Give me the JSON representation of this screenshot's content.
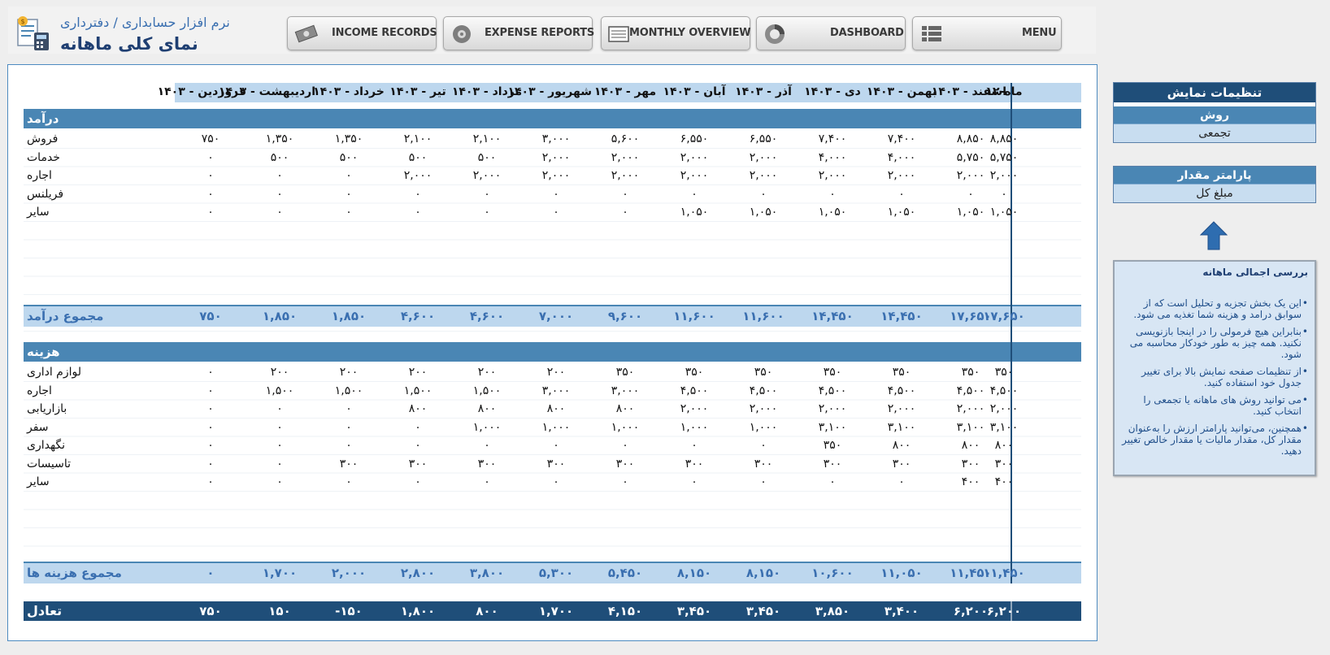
{
  "header": {
    "breadcrumb": "نرم افزار حسابداری / دفترداری",
    "title": "نمای کلی ماهانه"
  },
  "nav": [
    {
      "label": "INCOME RECORDS",
      "icon": "cash-icon"
    },
    {
      "label": "EXPENSE REPORTS",
      "icon": "gear-coin-icon"
    },
    {
      "label": "MONTHLY OVERVIEW",
      "icon": "ledger-icon"
    },
    {
      "label": "DASHBOARD",
      "icon": "donut-chart-icon"
    },
    {
      "label": "MENU",
      "icon": "list-icon"
    }
  ],
  "table": {
    "total_header": "ماه-۱۲",
    "months": [
      "اسفند - ۱۴۰۳",
      "بهمن - ۱۴۰۳",
      "دی - ۱۴۰۳",
      "آذر - ۱۴۰۳",
      "آبان - ۱۴۰۳",
      "مهر - ۱۴۰۳",
      "شهریور - ۱۴۰۳",
      "مرداد - ۱۴۰۳",
      "تیر - ۱۴۰۳",
      "خرداد - ۱۴۰۳",
      "اردیبهشت - ۱۴۰۳",
      "فروردین - ۱۴۰۳"
    ],
    "income": {
      "title": "درآمد",
      "rows": [
        {
          "label": "فروش",
          "total": "۸,۸۵۰",
          "values": [
            "۸,۸۵۰",
            "۷,۴۰۰",
            "۷,۴۰۰",
            "۶,۵۵۰",
            "۶,۵۵۰",
            "۵,۶۰۰",
            "۳,۰۰۰",
            "۲,۱۰۰",
            "۲,۱۰۰",
            "۱,۳۵۰",
            "۱,۳۵۰",
            "۷۵۰"
          ]
        },
        {
          "label": "خدمات",
          "total": "۵,۷۵۰",
          "values": [
            "۵,۷۵۰",
            "۴,۰۰۰",
            "۴,۰۰۰",
            "۲,۰۰۰",
            "۲,۰۰۰",
            "۲,۰۰۰",
            "۲,۰۰۰",
            "۵۰۰",
            "۵۰۰",
            "۵۰۰",
            "۵۰۰",
            "۰"
          ]
        },
        {
          "label": "اجاره",
          "total": "۲,۰۰۰",
          "values": [
            "۲,۰۰۰",
            "۲,۰۰۰",
            "۲,۰۰۰",
            "۲,۰۰۰",
            "۲,۰۰۰",
            "۲,۰۰۰",
            "۲,۰۰۰",
            "۲,۰۰۰",
            "۲,۰۰۰",
            "۰",
            "۰",
            "۰"
          ]
        },
        {
          "label": "فریلنس",
          "total": "۰",
          "values": [
            "۰",
            "۰",
            "۰",
            "۰",
            "۰",
            "۰",
            "۰",
            "۰",
            "۰",
            "۰",
            "۰",
            "۰"
          ]
        },
        {
          "label": "سایر",
          "total": "۱,۰۵۰",
          "values": [
            "۱,۰۵۰",
            "۱,۰۵۰",
            "۱,۰۵۰",
            "۱,۰۵۰",
            "۱,۰۵۰",
            "۰",
            "۰",
            "۰",
            "۰",
            "۰",
            "۰",
            "۰"
          ]
        }
      ],
      "total_label": "مجموع درآمد",
      "total_row": {
        "total": "۱۷,۶۵۰",
        "values": [
          "۱۷,۶۵۰",
          "۱۴,۴۵۰",
          "۱۴,۴۵۰",
          "۱۱,۶۰۰",
          "۱۱,۶۰۰",
          "۹,۶۰۰",
          "۷,۰۰۰",
          "۴,۶۰۰",
          "۴,۶۰۰",
          "۱,۸۵۰",
          "۱,۸۵۰",
          "۷۵۰"
        ]
      }
    },
    "expense": {
      "title": "هزینه",
      "rows": [
        {
          "label": "لوازم اداری",
          "total": "۳۵۰",
          "values": [
            "۳۵۰",
            "۳۵۰",
            "۳۵۰",
            "۳۵۰",
            "۳۵۰",
            "۳۵۰",
            "۲۰۰",
            "۲۰۰",
            "۲۰۰",
            "۲۰۰",
            "۲۰۰",
            "۰"
          ]
        },
        {
          "label": "اجاره",
          "total": "۴,۵۰۰",
          "values": [
            "۴,۵۰۰",
            "۴,۵۰۰",
            "۴,۵۰۰",
            "۴,۵۰۰",
            "۴,۵۰۰",
            "۳,۰۰۰",
            "۳,۰۰۰",
            "۱,۵۰۰",
            "۱,۵۰۰",
            "۱,۵۰۰",
            "۱,۵۰۰",
            "۰"
          ]
        },
        {
          "label": "بازاریابی",
          "total": "۲,۰۰۰",
          "values": [
            "۲,۰۰۰",
            "۲,۰۰۰",
            "۲,۰۰۰",
            "۲,۰۰۰",
            "۲,۰۰۰",
            "۸۰۰",
            "۸۰۰",
            "۸۰۰",
            "۸۰۰",
            "۰",
            "۰",
            "۰"
          ]
        },
        {
          "label": "سفر",
          "total": "۳,۱۰۰",
          "values": [
            "۳,۱۰۰",
            "۳,۱۰۰",
            "۳,۱۰۰",
            "۱,۰۰۰",
            "۱,۰۰۰",
            "۱,۰۰۰",
            "۱,۰۰۰",
            "۱,۰۰۰",
            "۰",
            "۰",
            "۰",
            "۰"
          ]
        },
        {
          "label": "نگهداری",
          "total": "۸۰۰",
          "values": [
            "۸۰۰",
            "۸۰۰",
            "۳۵۰",
            "۰",
            "۰",
            "۰",
            "۰",
            "۰",
            "۰",
            "۰",
            "۰",
            "۰"
          ]
        },
        {
          "label": "تاسیسات",
          "total": "۳۰۰",
          "values": [
            "۳۰۰",
            "۳۰۰",
            "۳۰۰",
            "۳۰۰",
            "۳۰۰",
            "۳۰۰",
            "۳۰۰",
            "۳۰۰",
            "۳۰۰",
            "۳۰۰",
            "۰",
            "۰"
          ]
        },
        {
          "label": "سایر",
          "total": "۴۰۰",
          "values": [
            "۴۰۰",
            "۰",
            "۰",
            "۰",
            "۰",
            "۰",
            "۰",
            "۰",
            "۰",
            "۰",
            "۰",
            "۰"
          ]
        }
      ],
      "total_label": "مجموع هزینه ها",
      "total_row": {
        "total": "۱۱,۴۵۰",
        "values": [
          "۱۱,۴۵۰",
          "۱۱,۰۵۰",
          "۱۰,۶۰۰",
          "۸,۱۵۰",
          "۸,۱۵۰",
          "۵,۴۵۰",
          "۵,۳۰۰",
          "۳,۸۰۰",
          "۲,۸۰۰",
          "۲,۰۰۰",
          "۱,۷۰۰",
          "۰"
        ]
      }
    },
    "balance": {
      "label": "تعادل",
      "total": "۶,۲۰۰",
      "values": [
        "۶,۲۰۰",
        "۳,۴۰۰",
        "۳,۸۵۰",
        "۳,۴۵۰",
        "۳,۴۵۰",
        "۴,۱۵۰",
        "۱,۷۰۰",
        "۸۰۰",
        "۱,۸۰۰",
        "-۱۵۰",
        "۱۵۰",
        "۷۵۰"
      ]
    }
  },
  "settings": {
    "title": "تنظیمات نمایش",
    "method_label": "روش",
    "method_value": "تجمعی",
    "param_label": "پارامتر مقدار",
    "param_value": "مبلغ کل"
  },
  "info": {
    "title": "بررسی اجمالی ماهانه",
    "bullets": [
      "این یک بخش تجزیه و تحلیل است که از سوابق درامد و هزینه شما تغذیه می شود.",
      "بنابراین هیچ فرمولی را در اینجا بازنویسی نکنید. همه چیز به طور خودکار محاسبه می شود.",
      "از تنظیمات صفحه نمایش بالا برای تغییر جدول خود استفاده کنید.",
      "می توانید روش های ماهانه یا تجمعی را انتخاب کنید.",
      "همچنین، می‌توانید پارامتر ارزش را به‌عنوان مقدار کل، مقدار مالیات یا مقدار خالص تغییر دهید."
    ]
  },
  "colors": {
    "dark_blue": "#1f4e79",
    "mid_blue": "#4a86b4",
    "light_blue": "#bdd7ee",
    "accent_text": "#3a6fb0"
  }
}
